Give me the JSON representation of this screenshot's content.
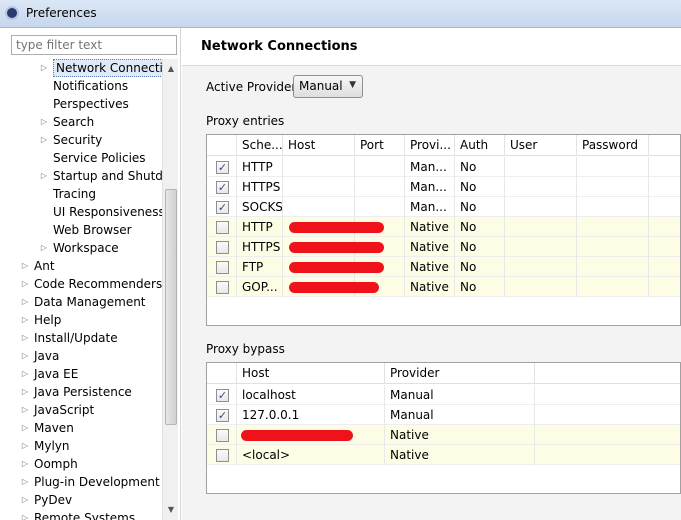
{
  "window": {
    "title": "Preferences"
  },
  "filter": {
    "placeholder": "type filter text"
  },
  "tree": {
    "items": [
      {
        "label": "Network Connections",
        "expandable": true,
        "level": 2,
        "selected": true
      },
      {
        "label": "Notifications",
        "expandable": false,
        "level": 2
      },
      {
        "label": "Perspectives",
        "expandable": false,
        "level": 2
      },
      {
        "label": "Search",
        "expandable": true,
        "level": 2
      },
      {
        "label": "Security",
        "expandable": true,
        "level": 2
      },
      {
        "label": "Service Policies",
        "expandable": false,
        "level": 2
      },
      {
        "label": "Startup and Shutdown",
        "expandable": true,
        "level": 2
      },
      {
        "label": "Tracing",
        "expandable": false,
        "level": 2
      },
      {
        "label": "UI Responsiveness Monitoring",
        "expandable": false,
        "level": 2
      },
      {
        "label": "Web Browser",
        "expandable": false,
        "level": 2
      },
      {
        "label": "Workspace",
        "expandable": true,
        "level": 2
      },
      {
        "label": "Ant",
        "expandable": true,
        "level": 1
      },
      {
        "label": "Code Recommenders",
        "expandable": true,
        "level": 1
      },
      {
        "label": "Data Management",
        "expandable": true,
        "level": 1
      },
      {
        "label": "Help",
        "expandable": true,
        "level": 1
      },
      {
        "label": "Install/Update",
        "expandable": true,
        "level": 1
      },
      {
        "label": "Java",
        "expandable": true,
        "level": 1
      },
      {
        "label": "Java EE",
        "expandable": true,
        "level": 1
      },
      {
        "label": "Java Persistence",
        "expandable": true,
        "level": 1
      },
      {
        "label": "JavaScript",
        "expandable": true,
        "level": 1
      },
      {
        "label": "Maven",
        "expandable": true,
        "level": 1
      },
      {
        "label": "Mylyn",
        "expandable": true,
        "level": 1
      },
      {
        "label": "Oomph",
        "expandable": true,
        "level": 1
      },
      {
        "label": "Plug-in Development",
        "expandable": true,
        "level": 1
      },
      {
        "label": "PyDev",
        "expandable": true,
        "level": 1
      },
      {
        "label": "Remote Systems",
        "expandable": true,
        "level": 1
      }
    ]
  },
  "page": {
    "title": "Network Connections",
    "active_provider_label": "Active Provider:",
    "active_provider_value": "Manual"
  },
  "proxy_entries": {
    "label": "Proxy entries",
    "columns": [
      "Sche...",
      "Host",
      "Port",
      "Provi...",
      "Auth",
      "User",
      "Password"
    ],
    "rows": [
      {
        "checked": true,
        "schema": "HTTP",
        "host": "",
        "port": "",
        "provider": "Man...",
        "auth": "No",
        "user": "",
        "password": "",
        "native": false,
        "redacted": false
      },
      {
        "checked": true,
        "schema": "HTTPS",
        "host": "",
        "port": "",
        "provider": "Man...",
        "auth": "No",
        "user": "",
        "password": "",
        "native": false,
        "redacted": false
      },
      {
        "checked": true,
        "schema": "SOCKS",
        "host": "",
        "port": "",
        "provider": "Man...",
        "auth": "No",
        "user": "",
        "password": "",
        "native": false,
        "redacted": false
      },
      {
        "checked": false,
        "schema": "HTTP",
        "host": "",
        "port": "",
        "provider": "Native",
        "auth": "No",
        "user": "",
        "password": "",
        "native": true,
        "redacted": true
      },
      {
        "checked": false,
        "schema": "HTTPS",
        "host": "",
        "port": "",
        "provider": "Native",
        "auth": "No",
        "user": "",
        "password": "",
        "native": true,
        "redacted": true
      },
      {
        "checked": false,
        "schema": "FTP",
        "host": "",
        "port": "",
        "provider": "Native",
        "auth": "No",
        "user": "",
        "password": "",
        "native": true,
        "redacted": true
      },
      {
        "checked": false,
        "schema": "GOP...",
        "host": "",
        "port": "",
        "provider": "Native",
        "auth": "No",
        "user": "",
        "password": "",
        "native": true,
        "redacted": true
      }
    ]
  },
  "proxy_bypass": {
    "label": "Proxy bypass",
    "columns": [
      "Host",
      "Provider"
    ],
    "rows": [
      {
        "checked": true,
        "host": "localhost",
        "provider": "Manual",
        "native": false,
        "redacted": false
      },
      {
        "checked": true,
        "host": "127.0.0.1",
        "provider": "Manual",
        "native": false,
        "redacted": false
      },
      {
        "checked": false,
        "host": "",
        "provider": "Native",
        "native": true,
        "redacted": true
      },
      {
        "checked": false,
        "host": "<local>",
        "provider": "Native",
        "native": true,
        "redacted": false
      }
    ]
  },
  "colors": {
    "native_row": "#fdfde6",
    "redaction": "#f0121b",
    "titlebar": "#c6d6ec"
  }
}
